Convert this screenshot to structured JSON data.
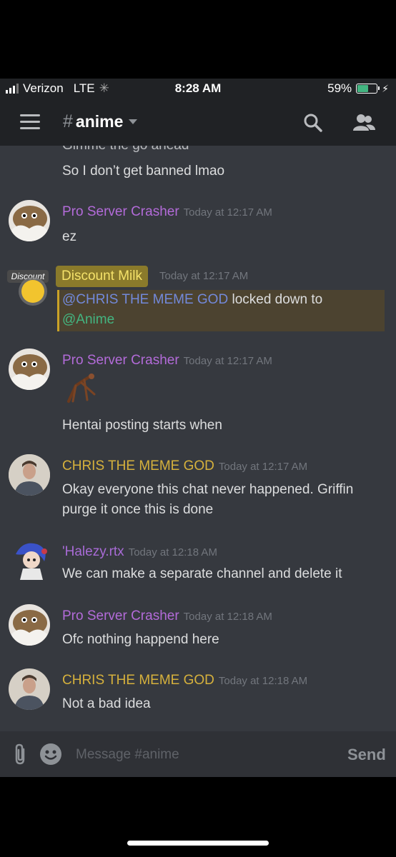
{
  "status_bar": {
    "carrier": "Verizon",
    "network": "LTE",
    "time": "8:28 AM",
    "battery_percent": "59%",
    "battery_level": 0.59
  },
  "header": {
    "channel_hash": "#",
    "channel_name": "anime",
    "icons": [
      "hamburger-menu-icon",
      "search-icon",
      "members-icon"
    ]
  },
  "messages": [
    {
      "text": "Gimme the go ahead"
    },
    {
      "text": "So I don’t get banned lmao"
    },
    {
      "author": "Pro Server Crasher",
      "timestamp": "Today at 12:17 AM",
      "text": "ez"
    },
    {
      "author": "Discount Milk",
      "timestamp": "Today at 12:17 AM",
      "mention": "@CHRIS THE MEME GOD",
      "text_mid": " locked down to",
      "role_mention": "@Anime",
      "avatar_text": "Discount"
    },
    {
      "author": "Pro Server Crasher",
      "timestamp": "Today at 12:17 AM",
      "text": "Hentai posting starts when"
    },
    {
      "author": "CHRIS THE MEME GOD",
      "timestamp": "Today at 12:17 AM",
      "text": "Okay everyone this chat never happened. Griffin purge it once this is done"
    },
    {
      "author": "'Halezy.rtx",
      "timestamp": "Today at 12:18 AM",
      "text": "We can make a separate channel and delete it"
    },
    {
      "author": "Pro Server Crasher",
      "timestamp": "Today at 12:18 AM",
      "text": "Ofc nothing happend here"
    },
    {
      "author": "CHRIS THE MEME GOD",
      "timestamp": "Today at 12:18 AM",
      "text": "Not a bad idea"
    }
  ],
  "composer": {
    "placeholder": "Message #anime",
    "send_label": "Send"
  },
  "colors": {
    "background": "#36393f",
    "header": "#202225",
    "pro_server_crasher": "#b36bd9",
    "chris": "#d6b13c",
    "halezy": "#a86bd6",
    "mention_highlight": "#4c4330"
  }
}
